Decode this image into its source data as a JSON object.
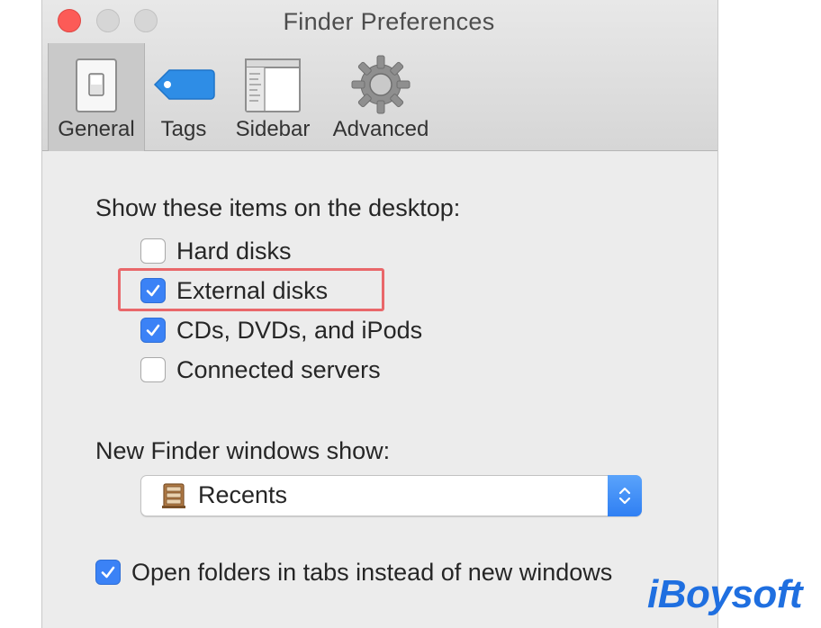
{
  "window": {
    "title": "Finder Preferences"
  },
  "tabs": [
    {
      "label": "General",
      "icon": "switch-icon",
      "selected": true
    },
    {
      "label": "Tags",
      "icon": "tag-icon",
      "selected": false
    },
    {
      "label": "Sidebar",
      "icon": "sidebar-window-icon",
      "selected": false
    },
    {
      "label": "Advanced",
      "icon": "gear-icon",
      "selected": false
    }
  ],
  "desktop": {
    "heading": "Show these items on the desktop:",
    "items": [
      {
        "label": "Hard disks",
        "checked": false
      },
      {
        "label": "External disks",
        "checked": true
      },
      {
        "label": "CDs, DVDs, and iPods",
        "checked": true
      },
      {
        "label": "Connected servers",
        "checked": false
      }
    ]
  },
  "new_window": {
    "heading": "New Finder windows show:",
    "selected": "Recents",
    "icon": "recents-icon"
  },
  "tabs_option": {
    "label": "Open folders in tabs instead of new windows",
    "checked": true
  },
  "watermark": "iBoysoft",
  "colors": {
    "accent": "#3b82f6",
    "highlight": "#e9676a",
    "close": "#fc5b57",
    "watermark": "#1f6fe0"
  }
}
